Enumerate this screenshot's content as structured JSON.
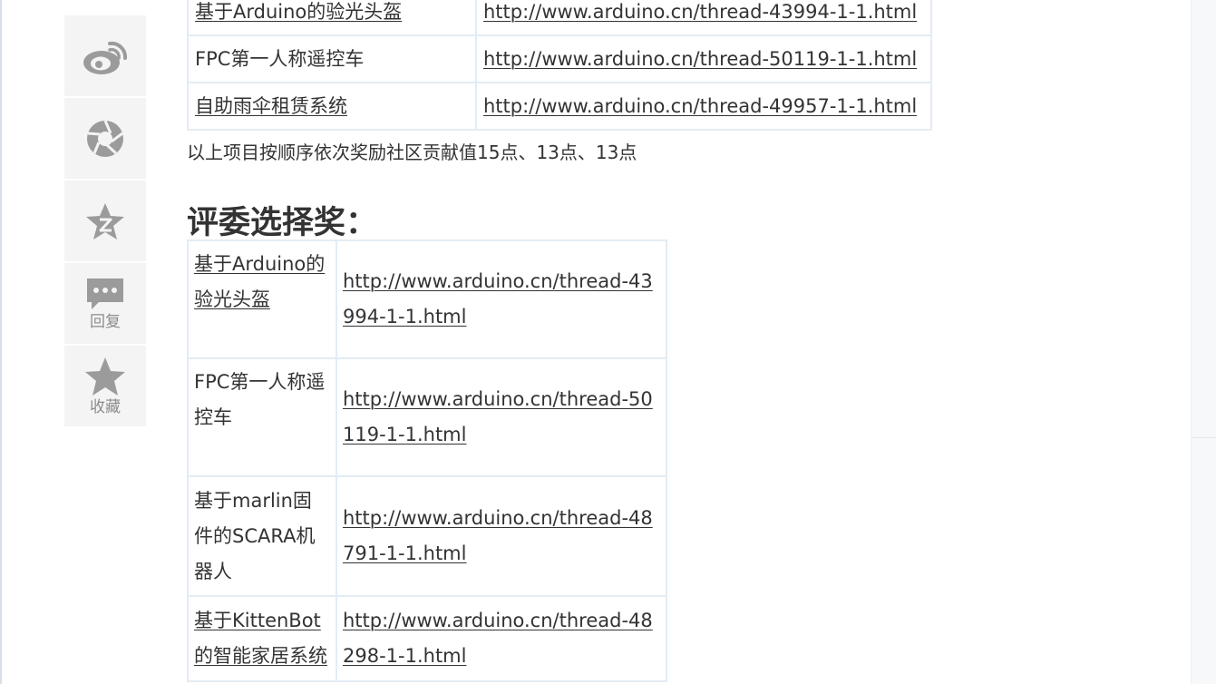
{
  "rail": {
    "weibo_label": "",
    "share_label": "",
    "zone_label": "",
    "reply_label": "回复",
    "favorite_label": "收藏"
  },
  "table1": {
    "rows": [
      {
        "name": "基于Arduino的验光头盔",
        "url": "http://www.arduino.cn/thread-43994-1-1.html"
      },
      {
        "name": "FPC第一人称遥控车",
        "url": "http://www.arduino.cn/thread-50119-1-1.html"
      },
      {
        "name": "自助雨伞租赁系统",
        "url": "http://www.arduino.cn/thread-49957-1-1.html"
      }
    ]
  },
  "note": "以上项目按顺序依次奖励社区贡献值15点、13点、13点",
  "heading": "评委选择奖：",
  "table2": {
    "rows": [
      {
        "name": "基于Arduino的验光头盔",
        "url": "http://www.arduino.cn/thread-43994-1-1.html"
      },
      {
        "name": "FPC第一人称遥控车",
        "url": "http://www.arduino.cn/thread-50119-1-1.html"
      },
      {
        "name": "基于marlin固件的SCARA机器人",
        "url": "http://www.arduino.cn/thread-48791-1-1.html"
      },
      {
        "name": "基于KittenBot的智能家居系统",
        "url": "http://www.arduino.cn/thread-48298-1-1.html"
      }
    ]
  },
  "colors": {
    "text": "#333333",
    "rail_bg": "#f4f4f4",
    "rail_icon": "#999999",
    "table_border": "#e3ecf4"
  }
}
